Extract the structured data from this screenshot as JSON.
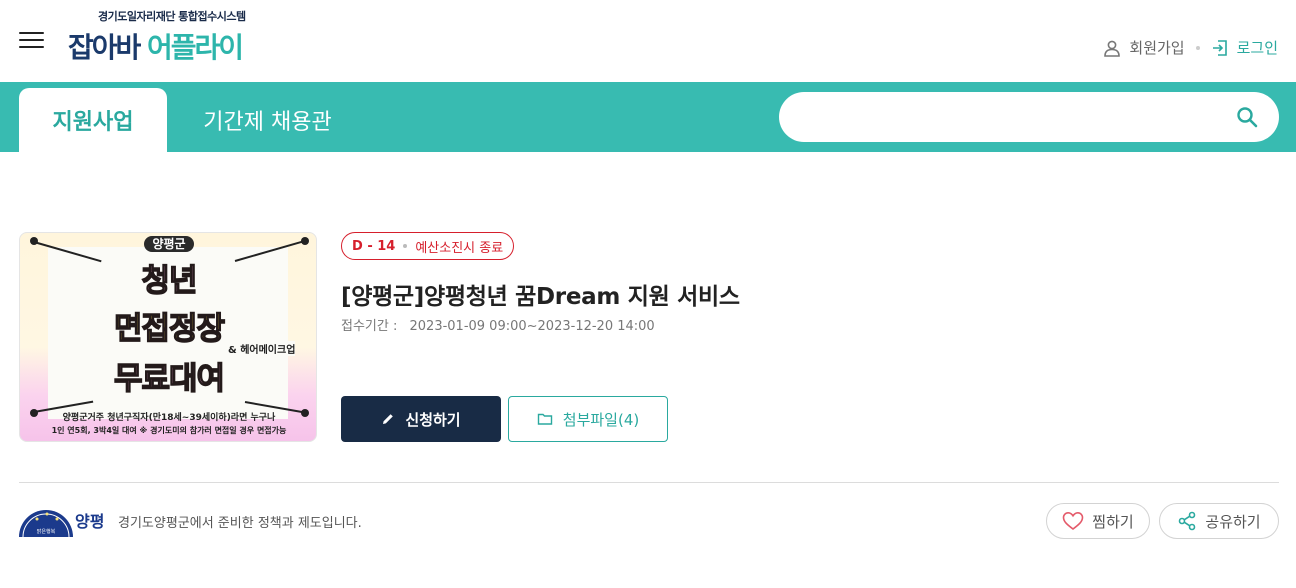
{
  "header": {
    "menu_icon": "hamburger-menu-icon",
    "logo_subtitle": "경기도일자리재단 통합접수시스템",
    "logo_part1": "잡아바",
    "logo_part2": "어플라이",
    "signup_label": "회원가입",
    "login_label": "로그인",
    "signup_icon": "user-icon",
    "login_icon": "login-icon"
  },
  "nav": {
    "tabs": [
      {
        "label": "지원사업",
        "active": true
      },
      {
        "label": "기간제 채용관",
        "active": false
      }
    ],
    "search": {
      "value": "",
      "placeholder": "",
      "icon": "search-icon"
    }
  },
  "program": {
    "d_day": "D - 14",
    "deadline_note": "예산소진시 종료",
    "title": "[양평군]양평청년 꿈Dream 지원 서비스",
    "period_label": "접수기간 :",
    "period_value": "2023-01-09 09:00~2023-12-20 14:00",
    "apply_label": "신청하기",
    "files_label": "첨부파일(4)",
    "poster": {
      "brand": "양평군",
      "line1": "청년",
      "line2": "면접정장",
      "line3": "무료대여",
      "tag": "& 헤어메이크업",
      "caption1": "양평군거주 청년구직자(만18세~39세이하)라면 누구나",
      "caption2": "1인 연5회, 3박4일 대여  ※ 경기도미의 참가러 면접일 경우 면접가능"
    }
  },
  "footer": {
    "org_logo_text": "양평",
    "org_logo_small": "맑은행복",
    "org_text": "경기도양평군에서 준비한 정책과 제도입니다.",
    "like_label": "찜하기",
    "share_label": "공유하기"
  },
  "colors": {
    "teal": "#38bbb1",
    "teal_text": "#2aa99f",
    "navy": "#182b45",
    "red": "#d61f2c"
  }
}
